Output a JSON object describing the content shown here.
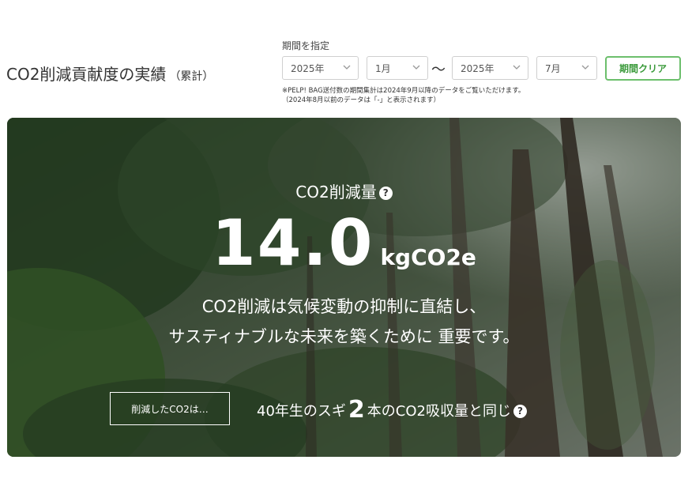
{
  "header": {
    "title": "CO2削減貢献度の実績",
    "title_suffix": "（累計）"
  },
  "period": {
    "label": "期間を指定",
    "start_year": "2025年",
    "start_month": "1月",
    "separator": "〜",
    "end_year": "2025年",
    "end_month": "7月",
    "clear_button": "期間クリア",
    "note_line1": "※PELP! BAG送付数の期間集計は2024年9月以降のデータをご覧いただけます。",
    "note_line2": "（2024年8月以前のデータは「-」と表示されます）"
  },
  "hero": {
    "metric_label": "CO2削減量",
    "help_icon": "question-circle-icon",
    "value": "14.0",
    "unit": "kgCO2e",
    "message_line1": "CO2削減は気候変動の抑制に直結し、",
    "message_line2": "サスティナブルな未来を築くために 重要です。",
    "reduced_button": "削減したCO2は…",
    "equiv_prefix": "40年生のスギ",
    "equiv_count": "2",
    "equiv_suffix": "本のCO2吸収量と同じ"
  },
  "colors": {
    "accent_green": "#6cbf6c",
    "hero_text": "#ffffff"
  }
}
